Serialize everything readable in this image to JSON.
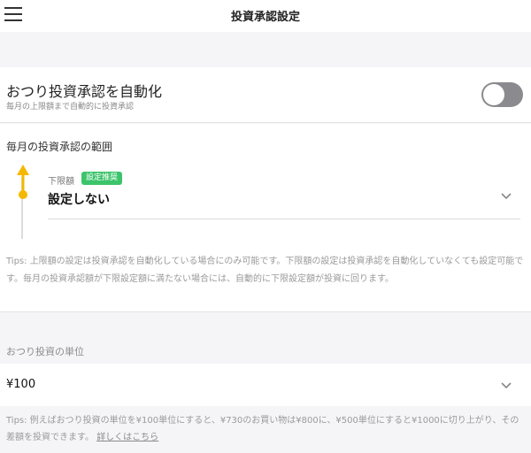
{
  "header": {
    "title": "投資承認設定",
    "menu_icon": "hamburger-icon"
  },
  "auto_approval": {
    "title": "おつり投資承認を自動化",
    "subtitle": "毎月の上限額まで自動的に投資承認",
    "toggle_on": false
  },
  "range": {
    "title": "毎月の投資承認の範囲",
    "lower_label": "下限額",
    "badge": "設定推奨",
    "selected_value": "設定しない",
    "tips": "Tips: 上限額の設定は投資承認を自動化している場合にのみ可能です。下限額の設定は投資承認を自動化していなくても設定可能です。毎月の投資承認額が下限設定額に満たない場合には、自動的に下限設定額が投資に回ります。",
    "accent_color": "#f5b800"
  },
  "unit": {
    "label": "おつり投資の単位",
    "value": "¥100",
    "tips": "Tips: 例えばおつり投資の単位を¥100単位にすると、¥730のお買い物は¥800に、¥500単位にすると¥1000に切り上がり、その差額を投資できます。",
    "link": "詳しくはこちら"
  },
  "colors": {
    "badge_green": "#3cc46b",
    "toggle_off": "#8a8a8f"
  }
}
